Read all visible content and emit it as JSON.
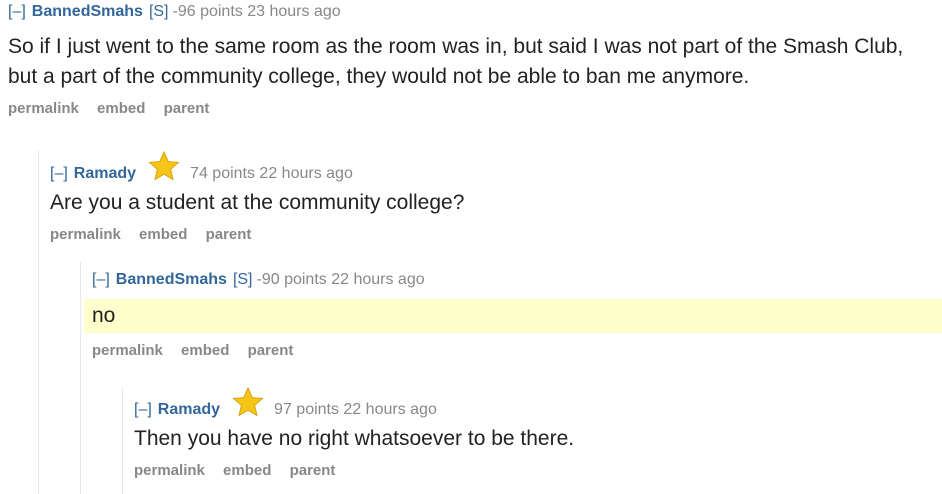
{
  "comments": [
    {
      "toggle": "[–]",
      "author": "BannedSmahs",
      "submitter": "[S]",
      "meta": "-96 points 23 hours ago",
      "body": "So if I just went to the same room as the room was in, but said I was not part of the Smash Club, but a part of the community college, they would not be able to ban me anymore.",
      "buttons": {
        "permalink": "permalink",
        "embed": "embed",
        "parent": "parent"
      }
    },
    {
      "toggle": "[–]",
      "author": "Ramady",
      "meta": "74 points 22 hours ago",
      "body": "Are you a student at the community college?",
      "buttons": {
        "permalink": "permalink",
        "embed": "embed",
        "parent": "parent"
      }
    },
    {
      "toggle": "[–]",
      "author": "BannedSmahs",
      "submitter": "[S]",
      "meta": "-90 points 22 hours ago",
      "body": "no",
      "buttons": {
        "permalink": "permalink",
        "embed": "embed",
        "parent": "parent"
      }
    },
    {
      "toggle": "[–]",
      "author": "Ramady",
      "meta": "97 points 22 hours ago",
      "body": "Then you have no right whatsoever to be there.",
      "buttons": {
        "permalink": "permalink",
        "embed": "embed",
        "parent": "parent"
      }
    }
  ],
  "colors": {
    "author": "#336699",
    "meta": "#888888",
    "highlight": "#ffffcc",
    "star": "#f5c518"
  },
  "icons": {
    "gilded": "gold-star-icon"
  }
}
